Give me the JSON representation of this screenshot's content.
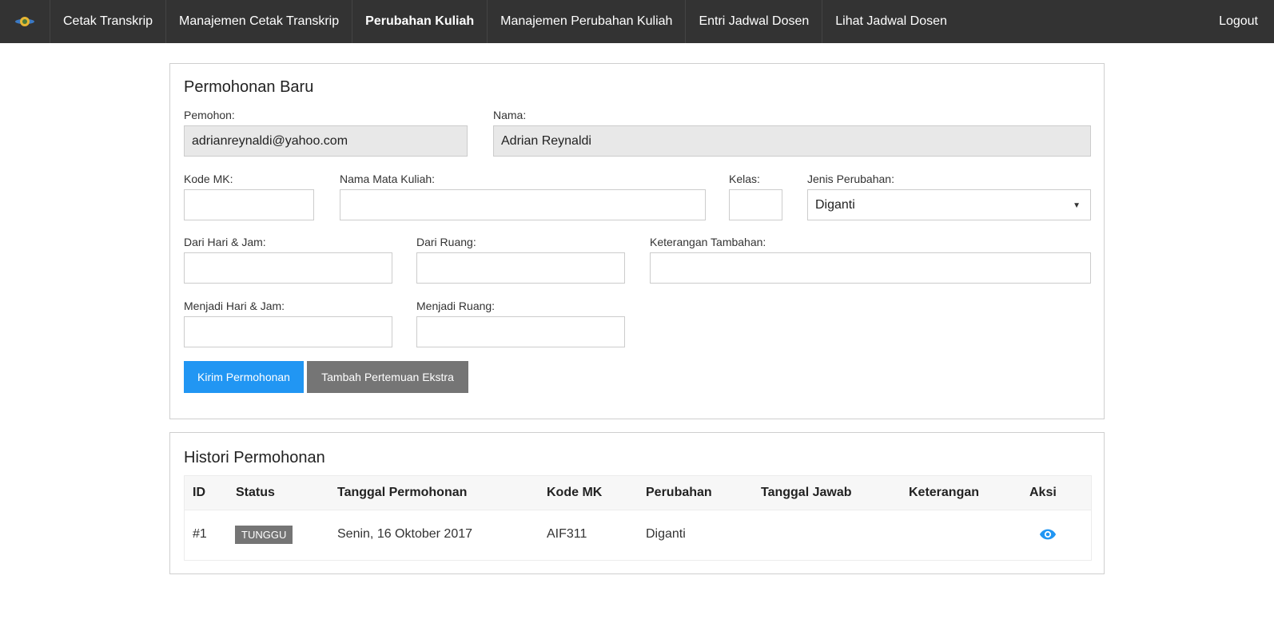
{
  "nav": {
    "items": [
      {
        "label": "Cetak Transkrip"
      },
      {
        "label": "Manajemen Cetak Transkrip"
      },
      {
        "label": "Perubahan Kuliah"
      },
      {
        "label": "Manajemen Perubahan Kuliah"
      },
      {
        "label": "Entri Jadwal Dosen"
      },
      {
        "label": "Lihat Jadwal Dosen"
      }
    ],
    "active_index": 2,
    "logout": "Logout"
  },
  "form": {
    "title": "Permohonan Baru",
    "pemohon_label": "Pemohon:",
    "pemohon_value": "adrianreynaldi@yahoo.com",
    "nama_label": "Nama:",
    "nama_value": "Adrian Reynaldi",
    "kode_mk_label": "Kode MK:",
    "nama_mk_label": "Nama Mata Kuliah:",
    "kelas_label": "Kelas:",
    "jenis_label": "Jenis Perubahan:",
    "jenis_value": "Diganti",
    "dari_hari_label": "Dari Hari & Jam:",
    "dari_ruang_label": "Dari Ruang:",
    "keterangan_label": "Keterangan Tambahan:",
    "menjadi_hari_label": "Menjadi Hari & Jam:",
    "menjadi_ruang_label": "Menjadi Ruang:",
    "submit_label": "Kirim Permohonan",
    "extra_label": "Tambah Pertemuan Ekstra"
  },
  "history": {
    "title": "Histori Permohonan",
    "columns": [
      "ID",
      "Status",
      "Tanggal Permohonan",
      "Kode MK",
      "Perubahan",
      "Tanggal Jawab",
      "Keterangan",
      "Aksi"
    ],
    "rows": [
      {
        "id": "#1",
        "status": "TUNGGU",
        "tanggal": "Senin, 16 Oktober 2017",
        "kode_mk": "AIF311",
        "perubahan": "Diganti",
        "tanggal_jawab": "",
        "keterangan": ""
      }
    ]
  },
  "colors": {
    "navbar": "#333333",
    "primary": "#2196f3",
    "secondary": "#757575",
    "eye_icon": "#2196f3"
  },
  "icons": {
    "logo": "logo-icon",
    "view": "eye-icon",
    "dropdown": "caret-down-icon"
  }
}
